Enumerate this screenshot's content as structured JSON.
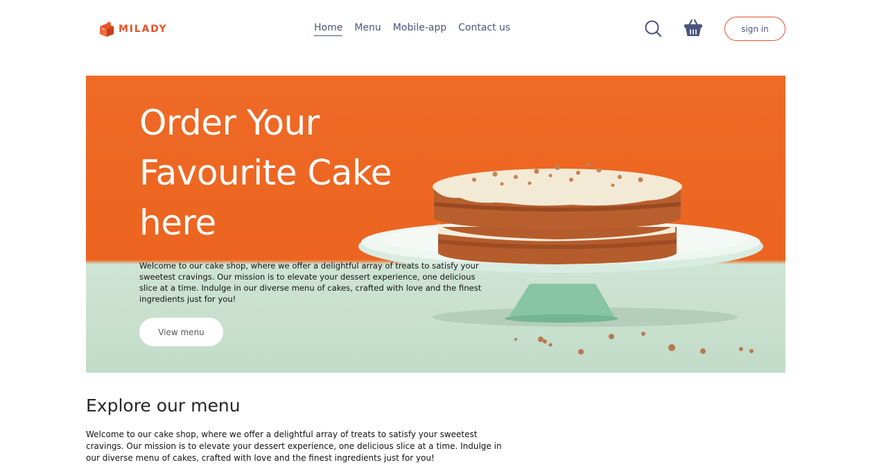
{
  "brand": {
    "name": "MILADY",
    "accent_color": "#e8532b"
  },
  "nav": {
    "links": [
      {
        "label": "Home",
        "active": true
      },
      {
        "label": "Menu",
        "active": false
      },
      {
        "label": "Mobile-app",
        "active": false
      },
      {
        "label": "Contact us",
        "active": false
      }
    ],
    "text_color": "#49557e"
  },
  "header": {
    "icons": [
      "search-icon",
      "basket-icon"
    ],
    "sign_in_label": "sign in"
  },
  "hero": {
    "title": "Order Your Favourite Cake here",
    "description": "Welcome to our cake shop, where we offer a delightful array of treats to satisfy your sweetest cravings. Our mission is to elevate your dessert experience, one delicious slice at a time. Indulge in our diverse menu of cakes, crafted with love and the finest ingredients just for you!",
    "button_label": "View menu",
    "background_color": "#ee6a26"
  },
  "explore": {
    "title": "Explore our menu",
    "description": "Welcome to our cake shop, where we offer a delightful array of treats to satisfy your sweetest cravings. Our mission is to elevate your dessert experience, one delicious slice at a time. Indulge in our diverse menu of cakes, crafted with love and the finest ingredients just for you!"
  }
}
